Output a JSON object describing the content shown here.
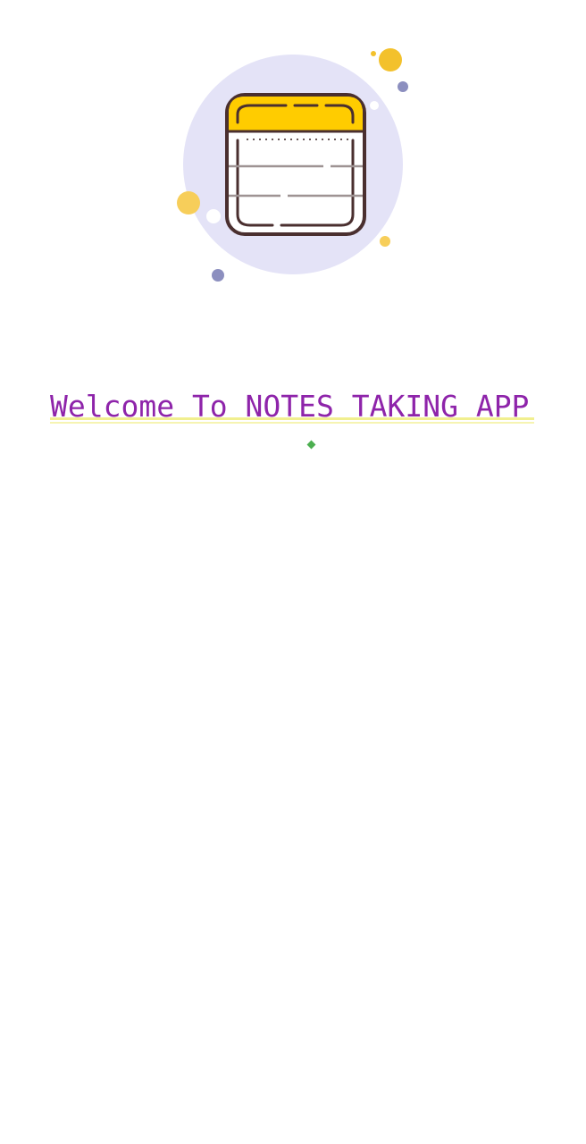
{
  "welcome": {
    "text": "Welcome To NOTES TAKING APP",
    "color": "#8e24aa",
    "underline_color": "#f1ef8f"
  },
  "illustration": {
    "icon": "notes-icon",
    "accent": "#ffcc00",
    "circle_color": "#e4e3f7",
    "outline_color": "#4a2f2f"
  },
  "loader": {
    "icon": "loading-indicator",
    "color": "#4caf50"
  }
}
